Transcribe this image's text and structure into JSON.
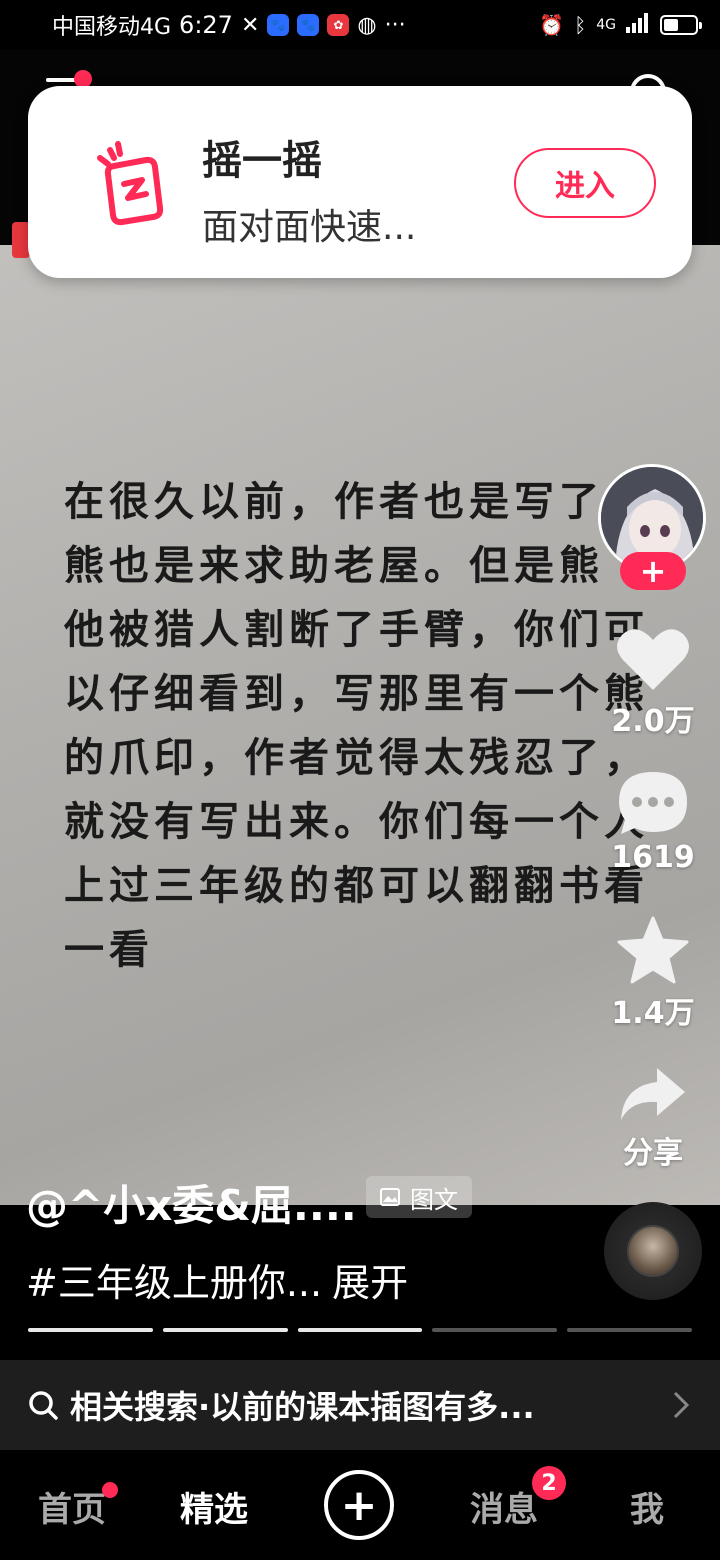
{
  "status_bar": {
    "carrier": "中国移动4G",
    "time": "6:27",
    "more": "···",
    "right_icons": [
      "alarm-icon",
      "bluetooth-icon",
      "signal-icon",
      "battery-icon"
    ],
    "network": "4G"
  },
  "banner": {
    "title": "摇一摇",
    "subtitle": "面对面快速...",
    "button": "进入",
    "accent": "#ff2a55"
  },
  "post": {
    "note_text": "在很久以前，作者也是写了\n熊也是来求助老屋。但是熊\n他被猎人割断了手臂，你们可\n以仔细看到，写那里有一个熊\n的爪印，作者觉得太残忍了，\n就没有写出来。你们每一个人\n上过三年级的都可以翻翻书看\n一看",
    "author": "@^小x委&屈....",
    "type_tag": "图文",
    "caption": "#三年级上册你...",
    "expand": "展开"
  },
  "actions": {
    "likes": "2.0万",
    "comments": "1619",
    "favorites": "1.4万",
    "share": "分享"
  },
  "related_search": {
    "label": "相关搜索·以前的课本插图有多..."
  },
  "progress": {
    "total": 5,
    "completed": 3
  },
  "bottom_nav": {
    "home": "首页",
    "featured": "精选",
    "messages": "消息",
    "messages_badge": "2",
    "me": "我"
  }
}
